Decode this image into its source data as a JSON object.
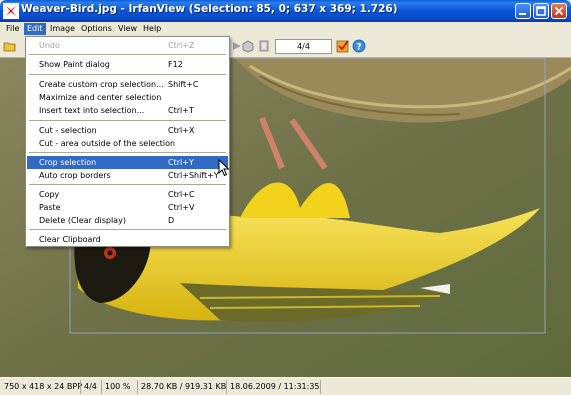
{
  "window": {
    "title": "Weaver-Bird.jpg - IrfanView (Selection: 85, 0; 637 x 369; 1.726)"
  },
  "menubar": {
    "items": [
      "File",
      "Edit",
      "Image",
      "Options",
      "View",
      "Help"
    ],
    "active": "Edit"
  },
  "toolbar": {
    "page_value": "4/4"
  },
  "edit_menu": {
    "items": [
      {
        "label": "Undo",
        "shortcut": "Ctrl+Z",
        "disabled": true
      },
      {
        "label": "Show Paint dialog",
        "shortcut": "F12"
      },
      {
        "label": "Create custom crop selection...",
        "shortcut": "Shift+C"
      },
      {
        "label": "Maximize and center selection",
        "shortcut": ""
      },
      {
        "label": "Insert text into selection...",
        "shortcut": "Ctrl+T"
      },
      {
        "label": "Cut - selection",
        "shortcut": "Ctrl+X"
      },
      {
        "label": "Cut - area outside of the selection",
        "shortcut": ""
      },
      {
        "label": "Crop selection",
        "shortcut": "Ctrl+Y",
        "highlighted": true
      },
      {
        "label": "Auto crop borders",
        "shortcut": "Ctrl+Shift+Y"
      },
      {
        "label": "Copy",
        "shortcut": "Ctrl+C"
      },
      {
        "label": "Paste",
        "shortcut": "Ctrl+V"
      },
      {
        "label": "Delete (Clear display)",
        "shortcut": "D"
      },
      {
        "label": "Clear Clipboard",
        "shortcut": ""
      }
    ]
  },
  "statusbar": {
    "dimensions": "750 x 418 x 24 BPP",
    "page": "4/4",
    "zoom": "100 %",
    "filesize": "28.70 KB / 919.31 KB",
    "datetime": "18.06.2009 / 11:31:35"
  },
  "colors": {
    "title_bar": "#0b56d8",
    "menu_highlight": "#316ac5",
    "bird_yellow": "#f2d21a",
    "background_olive": "#6e7148"
  }
}
